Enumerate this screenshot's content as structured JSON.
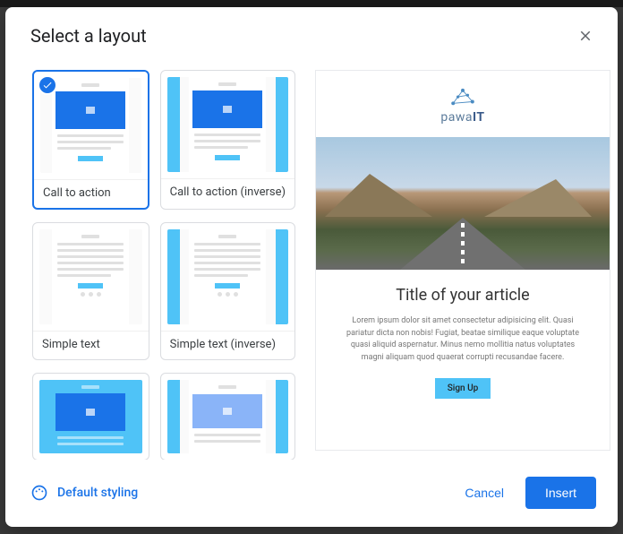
{
  "modal": {
    "title": "Select a layout",
    "layouts": [
      {
        "label": "Call to action",
        "selected": true
      },
      {
        "label": "Call to action (inverse)",
        "selected": false
      },
      {
        "label": "Simple text",
        "selected": false
      },
      {
        "label": "Simple text (inverse)",
        "selected": false
      },
      {
        "label": "",
        "selected": false
      },
      {
        "label": "",
        "selected": false
      }
    ]
  },
  "preview": {
    "brand_name_a": "pawa",
    "brand_name_b": "IT",
    "article_title": "Title of your article",
    "article_text": "Lorem ipsum dolor sit amet consectetur adipisicing elit. Quasi pariatur dicta non nobis! Fugiat, beatae similique eaque voluptate quasi aliquid aspernatur. Minus nemo mollitia natus voluptates magni aliquam quod quaerat corrupti recusandae facere.",
    "signup_label": "Sign Up"
  },
  "footer": {
    "styling_label": "Default styling",
    "cancel_label": "Cancel",
    "insert_label": "Insert"
  }
}
